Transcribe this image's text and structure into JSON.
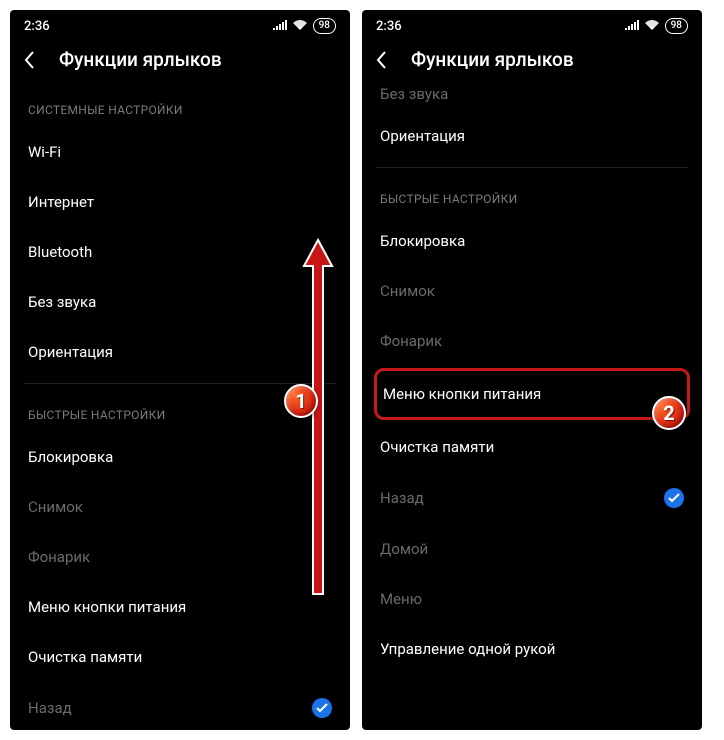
{
  "status": {
    "time": "2:36",
    "battery": "98"
  },
  "header": {
    "title": "Функции ярлыков"
  },
  "left": {
    "section1_label": "СИСТЕМНЫЕ НАСТРОЙКИ",
    "items1": {
      "wifi": "Wi-Fi",
      "internet": "Интернет",
      "bluetooth": "Bluetooth",
      "silent": "Без звука",
      "orientation": "Ориентация"
    },
    "section2_label": "БЫСТРЫЕ НАСТРОЙКИ",
    "items2": {
      "lock": "Блокировка",
      "screenshot": "Снимок",
      "flashlight": "Фонарик",
      "powermenu": "Меню кнопки питания",
      "clearmem": "Очистка памяти",
      "back": "Назад"
    }
  },
  "right": {
    "cutoff_top": "Без звука",
    "orientation": "Ориентация",
    "section_label": "БЫСТРЫЕ НАСТРОЙКИ",
    "items": {
      "lock": "Блокировка",
      "screenshot": "Снимок",
      "flashlight": "Фонарик",
      "powermenu": "Меню кнопки питания",
      "clearmem": "Очистка памяти",
      "back": "Назад",
      "home": "Домой",
      "menu": "Меню",
      "onehand": "Управление одной рукой"
    }
  },
  "annotations": {
    "step1": "1",
    "step2": "2"
  }
}
